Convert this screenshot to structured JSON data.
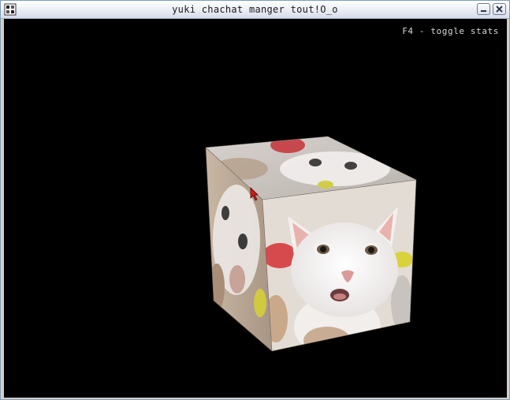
{
  "window": {
    "title": "yuki chachat manger tout!O_o"
  },
  "viewport": {
    "stats_hint": "F4 - toggle stats"
  },
  "colors": {
    "background": "#000000",
    "titlebar": "#e6eaf2",
    "cat_fur": "#f3f0ee",
    "ear_pink": "#e8b3ad",
    "nose_pink": "#d99a9a"
  },
  "icons": {
    "app": "app-icon",
    "minimize": "minimize-icon",
    "close": "close-icon",
    "cursor": "mouse-cursor-icon"
  }
}
